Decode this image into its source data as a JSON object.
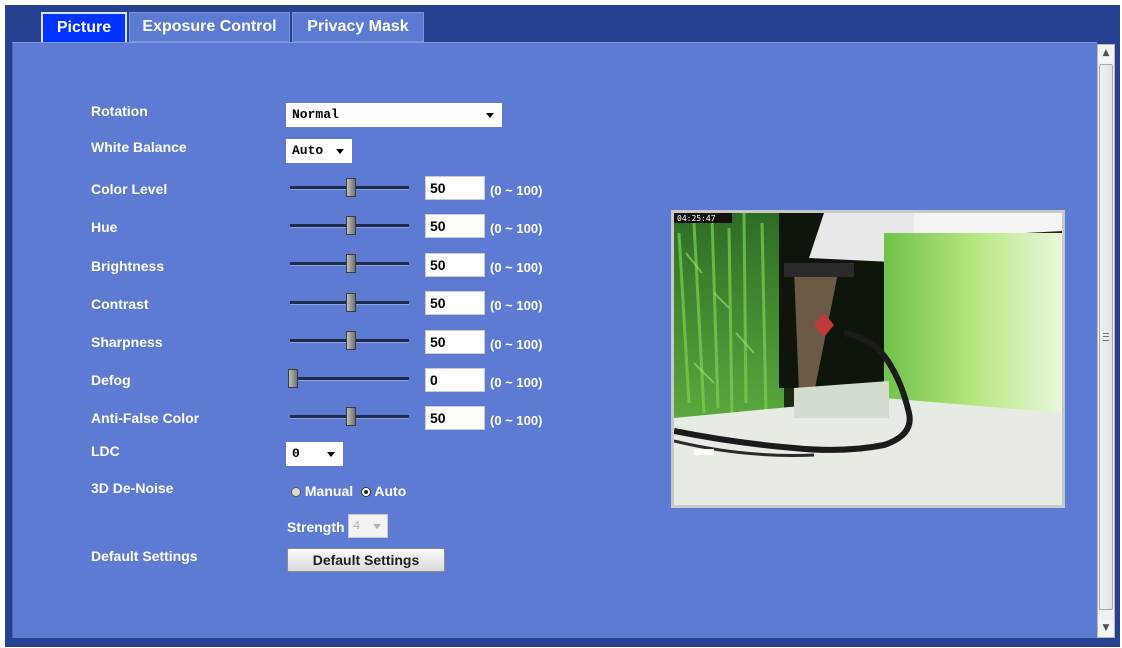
{
  "tabs": [
    {
      "label": "Picture",
      "active": true
    },
    {
      "label": "Exposure Control",
      "active": false
    },
    {
      "label": "Privacy Mask",
      "active": false
    }
  ],
  "settings": {
    "rotation": {
      "label": "Rotation",
      "value": "Normal"
    },
    "white_balance": {
      "label": "White Balance",
      "value": "Auto"
    },
    "color_level": {
      "label": "Color Level",
      "value": "50",
      "range": "(0 ~ 100)"
    },
    "hue": {
      "label": "Hue",
      "value": "50",
      "range": "(0 ~ 100)"
    },
    "brightness": {
      "label": "Brightness",
      "value": "50",
      "range": "(0 ~ 100)"
    },
    "contrast": {
      "label": "Contrast",
      "value": "50",
      "range": "(0 ~ 100)"
    },
    "sharpness": {
      "label": "Sharpness",
      "value": "50",
      "range": "(0 ~ 100)"
    },
    "defog": {
      "label": "Defog",
      "value": "0",
      "range": "(0 ~ 100)"
    },
    "anti_false_color": {
      "label": "Anti-False Color",
      "value": "50",
      "range": "(0 ~ 100)"
    },
    "ldc": {
      "label": "LDC",
      "value": "0"
    },
    "denoise": {
      "label": "3D De-Noise",
      "manual_label": "Manual",
      "auto_label": "Auto",
      "selected": "Auto",
      "strength_label": "Strength",
      "strength_value": "4"
    },
    "default": {
      "label": "Default Settings",
      "button_label": "Default Settings"
    }
  },
  "preview": {
    "timestamp": "04:25:47"
  },
  "colors": {
    "frame": "#25418f",
    "panel": "#5e7bd4",
    "active_tab": "#0033ff"
  }
}
